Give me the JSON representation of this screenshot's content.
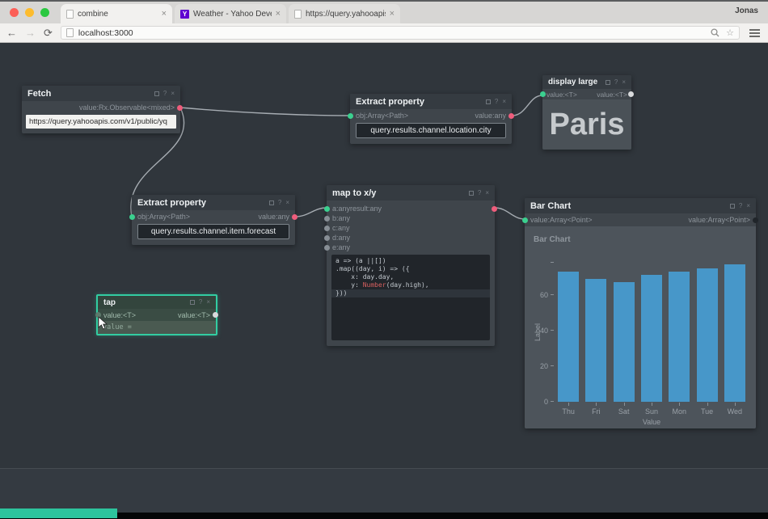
{
  "browser": {
    "profile_name": "Jonas",
    "tabs": [
      {
        "title": "combine"
      },
      {
        "title": "Weather - Yahoo Develope"
      },
      {
        "title": "https://query.yahooapis.co"
      }
    ],
    "tab_close_glyph": "×",
    "url": "localhost:3000",
    "nav": {
      "back": "←",
      "forward": "→",
      "reload": "⟳",
      "star": "☆"
    },
    "yahoo_favicon_letter": "Y"
  },
  "node_chrome": {
    "help_glyph": "?",
    "close_glyph": "×"
  },
  "nodes": {
    "fetch": {
      "title": "Fetch",
      "output_label": "value:Rx.Observable<mixed>",
      "input_value": "https://query.yahooapis.com/v1/public/yq"
    },
    "extract_city": {
      "title": "Extract property",
      "input_label": "obj:Array<Path>",
      "output_label": "value:any",
      "path_value": "query.results.channel.location.city"
    },
    "display_large": {
      "title": "display large",
      "input_label": "value:<T>",
      "output_label": "value:<T>",
      "value": "Paris"
    },
    "extract_forecast": {
      "title": "Extract property",
      "input_label": "obj:Array<Path>",
      "output_label": "value:any",
      "path_value": "query.results.channel.item.forecast"
    },
    "map_to_xy": {
      "title": "map to x/y",
      "inputs": [
        "a:any",
        "b:any",
        "c:any",
        "d:any",
        "e:any"
      ],
      "output_label": "result:any",
      "code_lines": [
        {
          "segments": [
            {
              "t": "a => (a ||[])"
            }
          ]
        },
        {
          "segments": [
            {
              "t": ".map((day, i) => ({"
            }
          ]
        },
        {
          "segments": [
            {
              "t": "    x: day.day,"
            }
          ]
        },
        {
          "segments": [
            {
              "t": "    y: "
            },
            {
              "t": "Number",
              "c": "keyword"
            },
            {
              "t": "(day.high),"
            }
          ]
        },
        {
          "segments": [
            {
              "t": "}))"
            }
          ],
          "active": true
        }
      ]
    },
    "tap": {
      "title": "tap",
      "input_label": "value:<T>",
      "output_label": "value:<T>",
      "value": "value ="
    },
    "bar_chart": {
      "title": "Bar Chart",
      "input_label": "value:Array<Point>",
      "output_label": "value:Array<Point>"
    }
  },
  "chart_data": {
    "type": "bar",
    "title": "Bar Chart",
    "categories": [
      "Thu",
      "Fri",
      "Sat",
      "Sun",
      "Mon",
      "Tue",
      "Wed"
    ],
    "values": [
      73,
      69,
      67,
      71,
      73,
      75,
      77
    ],
    "xlabel": "Value",
    "ylabel": "Label",
    "yticks": [
      0,
      20,
      40,
      60
    ],
    "ylim": [
      0,
      78
    ],
    "grid": false,
    "legend": false,
    "bar_color": "#4797c9"
  },
  "colors": {
    "port_in": "#3bd08f",
    "port_out": "#ef5d7c",
    "port_idle": "#878e95",
    "wire": "#a6acb2",
    "selection": "#32cda2"
  }
}
